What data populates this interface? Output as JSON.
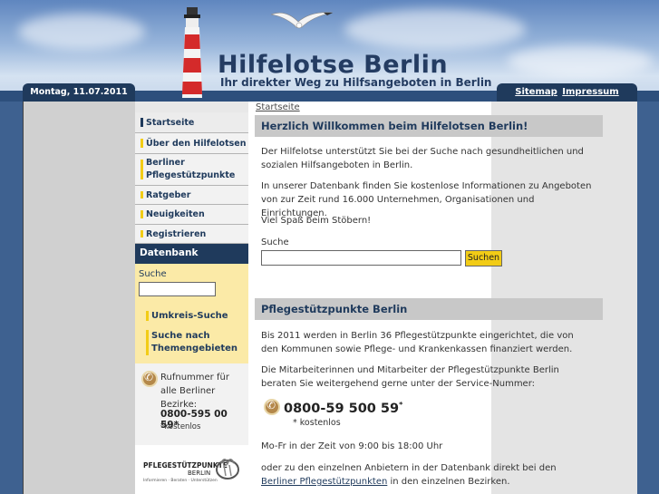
{
  "header": {
    "title": "Hilfelotse Berlin",
    "subtitle": "Ihr direkter Weg zu Hilfsangeboten in Berlin",
    "date": "Montag, 11.07.2011",
    "links": [
      "Sitemap",
      "Impressum"
    ]
  },
  "nav": {
    "items": [
      {
        "label": "Startseite"
      },
      {
        "label": "Über den Hilfelotsen"
      },
      {
        "label": "Berliner Pflegestützpunkte"
      },
      {
        "label": "Ratgeber"
      },
      {
        "label": "Neuigkeiten"
      },
      {
        "label": "Registrieren"
      }
    ]
  },
  "database": {
    "heading": "Datenbank",
    "search_label": "Suche",
    "links": [
      "Umkreis-Suche",
      "Suche nach Themengebieten"
    ]
  },
  "phonebox": {
    "text": "Rufnummer für alle Berliner Bezirke:",
    "number": "0800-595 00 59*",
    "note": "*kostenlos"
  },
  "logo": {
    "main": "PFLEGESTÜTZPUNKTE",
    "sub1": "BERLIN",
    "sub2": "Informieren · Beraten · Unterstützen"
  },
  "main": {
    "breadcrumb": "Startseite",
    "welcome_heading": "Herzlich Willkommen beim Hilfelotsen Berlin!",
    "p1": "Der Hilfelotse unterstützt Sie bei der Suche nach gesundheitlichen und sozialen Hilfsangeboten in Berlin.",
    "p2": "In unserer Datenbank finden Sie kostenlose Informationen zu Angeboten von zur Zeit rund 16.000 Unternehmen, Organisationen und Einrichtungen.",
    "p3": "Viel Spaß beim Stöbern!",
    "search_label": "Suche",
    "search_button": "Suchen",
    "pflege_heading": "Pflegestützpunkte Berlin",
    "p4": "Bis 2011 werden in Berlin 36 Pflegestützpunkte eingerichtet, die von den Kommunen sowie Pflege- und Krankenkassen finanziert werden.",
    "p5": "Die Mitarbeiterinnen und Mitarbeiter der Pflegestützpunkte Berlin beraten Sie weitergehend gerne unter der Service-Nummer:",
    "phone": "0800-59 500 59",
    "phone_mark": "*",
    "phone_note": "* kostenlos",
    "hours": "Mo-Fr in der Zeit von 9:00 bis 18:00 Uhr",
    "p6_pre": "oder zu den einzelnen Anbietern in der Datenbank direkt bei den ",
    "p6_link": "Berliner Pflegestützpunkten",
    "p6_post": " in den einzelnen Bezirken."
  },
  "colors": {
    "navy": "#1f3a5c",
    "yellow": "#f2cc16",
    "db_bg": "#fbeaa7"
  }
}
